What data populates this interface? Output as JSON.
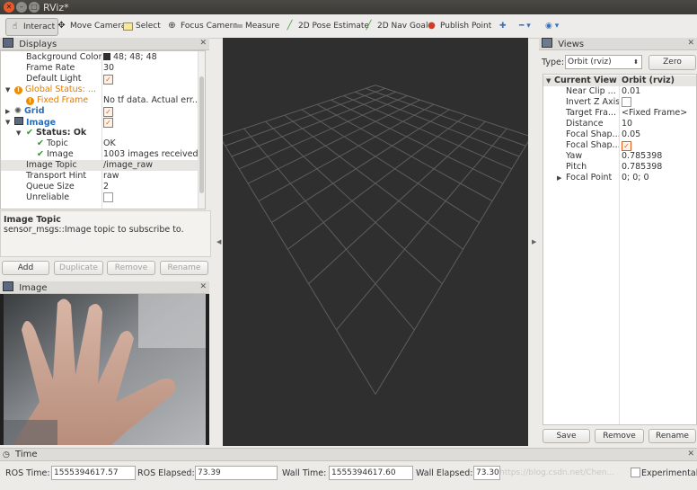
{
  "window": {
    "title": "RViz*"
  },
  "toolbar": {
    "interact": "Interact",
    "move_camera": "Move Camera",
    "select": "Select",
    "focus_camera": "Focus Camera",
    "measure": "Measure",
    "pose_estimate": "2D Pose Estimate",
    "nav_goal": "2D Nav Goal",
    "publish_point": "Publish Point"
  },
  "displays": {
    "title": "Displays",
    "rows": [
      {
        "name": "Background Color",
        "value": "48; 48; 48"
      },
      {
        "name": "Frame Rate",
        "value": "30"
      },
      {
        "name": "Default Light",
        "value": ""
      },
      {
        "name": "Global Status: ...",
        "value": ""
      },
      {
        "name": "Fixed Frame",
        "value": "No tf data.  Actual err..."
      },
      {
        "name": "Grid",
        "value": ""
      },
      {
        "name": "Image",
        "value": ""
      },
      {
        "name": "Status: Ok",
        "value": ""
      },
      {
        "name": "Topic",
        "value": "OK"
      },
      {
        "name": "Image",
        "value": "1003 images received"
      },
      {
        "name": "Image Topic",
        "value": "/image_raw"
      },
      {
        "name": "Transport Hint",
        "value": "raw"
      },
      {
        "name": "Queue Size",
        "value": "2"
      },
      {
        "name": "Unreliable",
        "value": ""
      }
    ],
    "description_title": "Image Topic",
    "description_text": "sensor_msgs::Image topic to subscribe to.",
    "buttons": {
      "add": "Add",
      "duplicate": "Duplicate",
      "remove": "Remove",
      "rename": "Rename"
    }
  },
  "image_panel": {
    "title": "Image"
  },
  "views": {
    "title": "Views",
    "type_label": "Type:",
    "type_value": "Orbit (rviz)",
    "zero": "Zero",
    "header_name": "Current View",
    "header_value": "Orbit (rviz)",
    "rows": [
      {
        "name": "Near Clip ...",
        "value": "0.01"
      },
      {
        "name": "Invert Z Axis",
        "value": ""
      },
      {
        "name": "Target Fra...",
        "value": "<Fixed Frame>"
      },
      {
        "name": "Distance",
        "value": "10"
      },
      {
        "name": "Focal Shap...",
        "value": "0.05"
      },
      {
        "name": "Focal Shap...",
        "value": ""
      },
      {
        "name": "Yaw",
        "value": "0.785398"
      },
      {
        "name": "Pitch",
        "value": "0.785398"
      },
      {
        "name": "Focal Point",
        "value": "0; 0; 0"
      }
    ],
    "buttons": {
      "save": "Save",
      "remove": "Remove",
      "rename": "Rename"
    }
  },
  "time": {
    "title": "Time",
    "ros_time_label": "ROS Time:",
    "ros_time": "1555394617.57",
    "ros_elapsed_label": "ROS Elapsed:",
    "ros_elapsed": "73.39",
    "wall_time_label": "Wall Time:",
    "wall_time": "1555394617.60",
    "wall_elapsed_label": "Wall Elapsed:",
    "wall_elapsed": "73.30",
    "experimental": "Experimental",
    "watermark": "https://blog.csdn.net/Chen..."
  }
}
